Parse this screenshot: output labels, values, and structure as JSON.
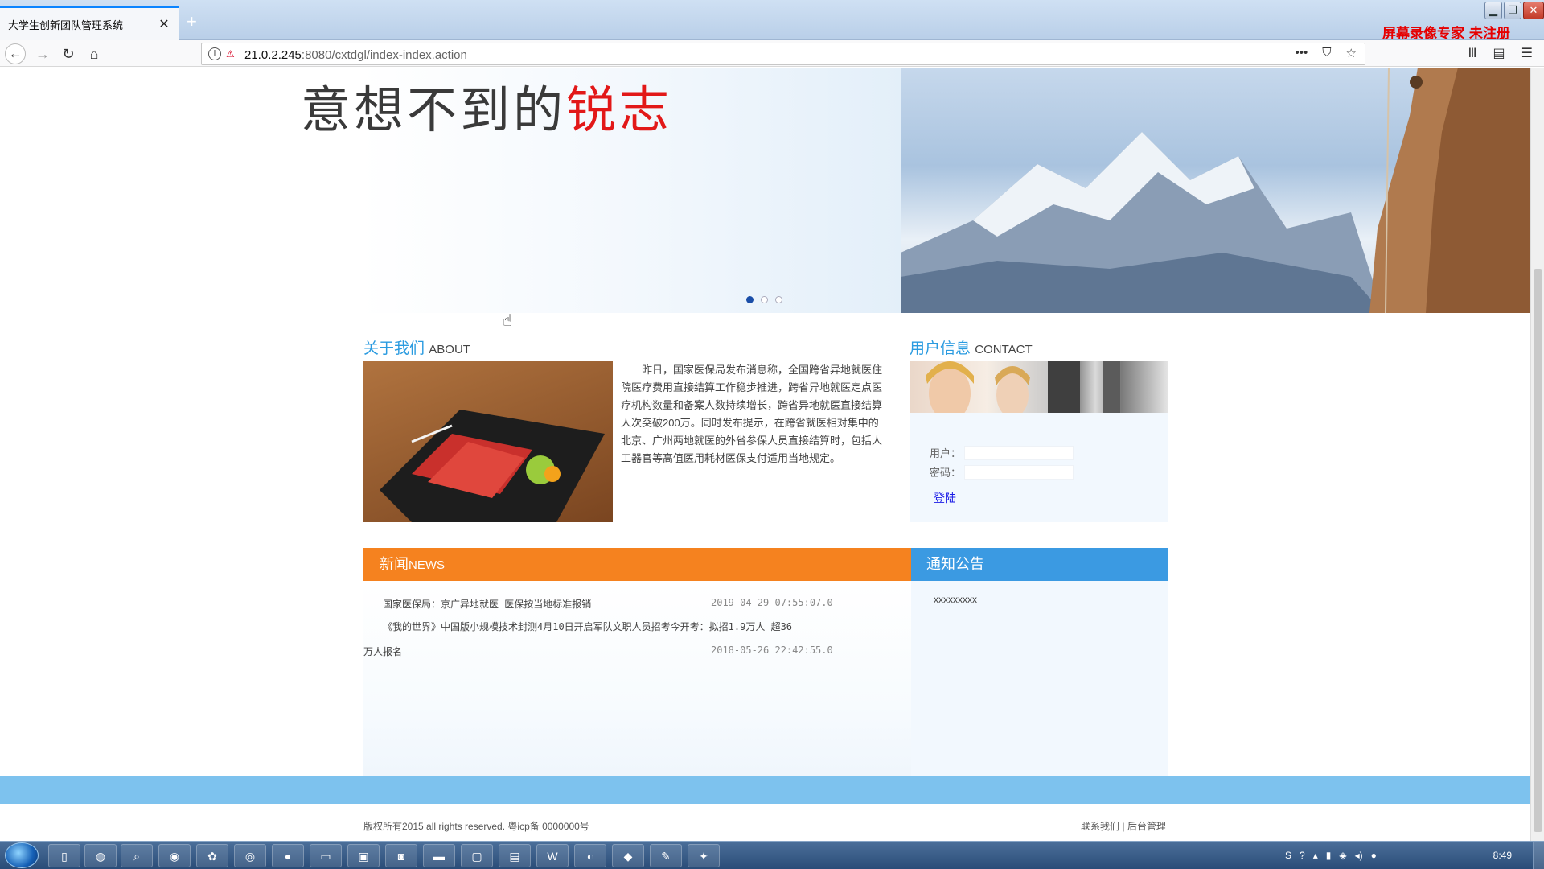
{
  "browser": {
    "tab_title": "大学生创新团队管理系统",
    "tab_close": "✕",
    "new_tab": "+",
    "url_host": "21.0.2.245",
    "url_rest": ":8080/cxtdgl/index-index.action",
    "recorder_label": "屏幕录像专家  未注册"
  },
  "banner": {
    "slogan_dark": "意想不到的",
    "slogan_red": "锐志",
    "slides_count": 3,
    "active_slide": 1
  },
  "about": {
    "title_cn": "关于我们",
    "title_en": "ABOUT",
    "text": "昨日，国家医保局发布消息称，全国跨省异地就医住院医疗费用直接结算工作稳步推进，跨省异地就医定点医疗机构数量和备案人数持续增长，跨省异地就医直接结算人次突破200万。同时发布提示，在跨省就医相对集中的北京、广州两地就医的外省参保人员直接结算时，包括人工器官等高值医用耗材医保支付适用当地规定。"
  },
  "contact": {
    "title_cn": "用户信息",
    "title_en": "CONTACT",
    "user_label": "用户：",
    "password_label": "密码：",
    "login_label": "登陆"
  },
  "news": {
    "title_cn": "新闻",
    "title_en": "NEWS",
    "items": [
      {
        "title": "国家医保局：京广异地就医 医保按当地标准报销",
        "date": "2019-04-29 07:55:07.0"
      },
      {
        "title_line1": "《我的世界》中国版小规模技术封测4月10日开启军队文职人员招考今开考：拟招1.9万人 超36",
        "title_line2": "万人报名",
        "date": "2018-05-26 22:42:55.0"
      }
    ]
  },
  "notice": {
    "title": "通知公告",
    "items": [
      "xxxxxxxxx"
    ]
  },
  "footer": {
    "copyright": "版权所有2015 all rights reserved. 粤icp备 0000000号",
    "link_contact": "联系我们",
    "separator": "|",
    "link_admin": "后台管理"
  },
  "taskbar": {
    "clock": "8:49"
  },
  "colors": {
    "news_orange": "#f5821f",
    "notice_blue": "#3b9ae2",
    "footer_band": "#7dc2ee",
    "section_title": "#2a9be0",
    "slogan_red": "#e21818"
  }
}
